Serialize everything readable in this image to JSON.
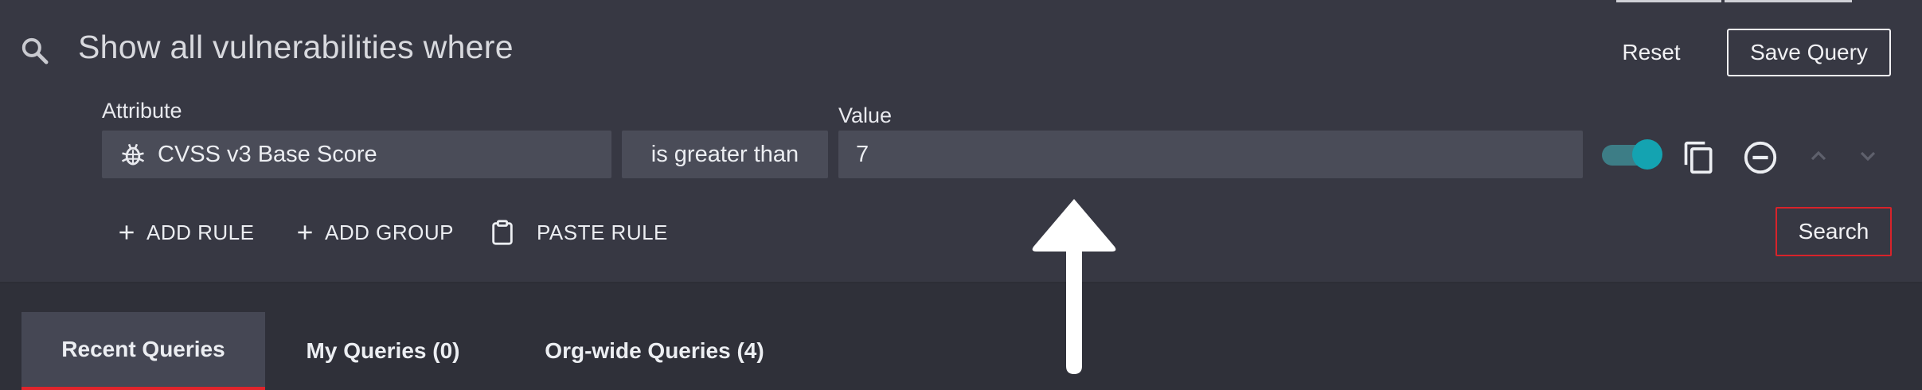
{
  "header": {
    "title": "Show all vulnerabilities where",
    "reset_label": "Reset",
    "save_label": "Save Query"
  },
  "rule": {
    "attribute_label": "Attribute",
    "attribute_value": "CVSS v3 Base Score",
    "attribute_icon": "bug-icon",
    "operator": "is greater than",
    "value_label": "Value",
    "value": "7",
    "enabled": true
  },
  "actions": {
    "add_rule": "ADD RULE",
    "add_group": "ADD GROUP",
    "paste_rule": "PASTE RULE",
    "search": "Search"
  },
  "tabs": [
    {
      "label": "Recent Queries",
      "active": true
    },
    {
      "label": "My Queries (0)",
      "active": false
    },
    {
      "label": "Org-wide Queries (4)",
      "active": false
    }
  ],
  "colors": {
    "background": "#373843",
    "field": "#4a4c58",
    "toggle": "#14a3b1",
    "accent_red": "#e0242b"
  }
}
